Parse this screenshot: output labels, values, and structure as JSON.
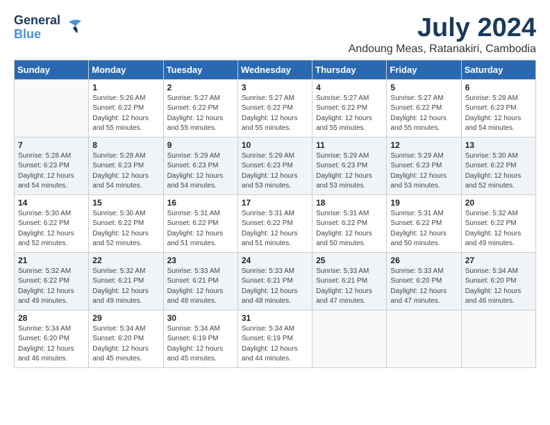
{
  "header": {
    "logo_general": "General",
    "logo_blue": "Blue",
    "month_year": "July 2024",
    "location": "Andoung Meas, Ratanakiri, Cambodia"
  },
  "weekdays": [
    "Sunday",
    "Monday",
    "Tuesday",
    "Wednesday",
    "Thursday",
    "Friday",
    "Saturday"
  ],
  "weeks": [
    [
      {
        "day": "",
        "info": ""
      },
      {
        "day": "1",
        "info": "Sunrise: 5:26 AM\nSunset: 6:22 PM\nDaylight: 12 hours\nand 55 minutes."
      },
      {
        "day": "2",
        "info": "Sunrise: 5:27 AM\nSunset: 6:22 PM\nDaylight: 12 hours\nand 55 minutes."
      },
      {
        "day": "3",
        "info": "Sunrise: 5:27 AM\nSunset: 6:22 PM\nDaylight: 12 hours\nand 55 minutes."
      },
      {
        "day": "4",
        "info": "Sunrise: 5:27 AM\nSunset: 6:22 PM\nDaylight: 12 hours\nand 55 minutes."
      },
      {
        "day": "5",
        "info": "Sunrise: 5:27 AM\nSunset: 6:22 PM\nDaylight: 12 hours\nand 55 minutes."
      },
      {
        "day": "6",
        "info": "Sunrise: 5:28 AM\nSunset: 6:23 PM\nDaylight: 12 hours\nand 54 minutes."
      }
    ],
    [
      {
        "day": "7",
        "info": "Sunrise: 5:28 AM\nSunset: 6:23 PM\nDaylight: 12 hours\nand 54 minutes."
      },
      {
        "day": "8",
        "info": "Sunrise: 5:28 AM\nSunset: 6:23 PM\nDaylight: 12 hours\nand 54 minutes."
      },
      {
        "day": "9",
        "info": "Sunrise: 5:29 AM\nSunset: 6:23 PM\nDaylight: 12 hours\nand 54 minutes."
      },
      {
        "day": "10",
        "info": "Sunrise: 5:29 AM\nSunset: 6:23 PM\nDaylight: 12 hours\nand 53 minutes."
      },
      {
        "day": "11",
        "info": "Sunrise: 5:29 AM\nSunset: 6:23 PM\nDaylight: 12 hours\nand 53 minutes."
      },
      {
        "day": "12",
        "info": "Sunrise: 5:29 AM\nSunset: 6:23 PM\nDaylight: 12 hours\nand 53 minutes."
      },
      {
        "day": "13",
        "info": "Sunrise: 5:30 AM\nSunset: 6:22 PM\nDaylight: 12 hours\nand 52 minutes."
      }
    ],
    [
      {
        "day": "14",
        "info": "Sunrise: 5:30 AM\nSunset: 6:22 PM\nDaylight: 12 hours\nand 52 minutes."
      },
      {
        "day": "15",
        "info": "Sunrise: 5:30 AM\nSunset: 6:22 PM\nDaylight: 12 hours\nand 52 minutes."
      },
      {
        "day": "16",
        "info": "Sunrise: 5:31 AM\nSunset: 6:22 PM\nDaylight: 12 hours\nand 51 minutes."
      },
      {
        "day": "17",
        "info": "Sunrise: 5:31 AM\nSunset: 6:22 PM\nDaylight: 12 hours\nand 51 minutes."
      },
      {
        "day": "18",
        "info": "Sunrise: 5:31 AM\nSunset: 6:22 PM\nDaylight: 12 hours\nand 50 minutes."
      },
      {
        "day": "19",
        "info": "Sunrise: 5:31 AM\nSunset: 6:22 PM\nDaylight: 12 hours\nand 50 minutes."
      },
      {
        "day": "20",
        "info": "Sunrise: 5:32 AM\nSunset: 6:22 PM\nDaylight: 12 hours\nand 49 minutes."
      }
    ],
    [
      {
        "day": "21",
        "info": "Sunrise: 5:32 AM\nSunset: 6:22 PM\nDaylight: 12 hours\nand 49 minutes."
      },
      {
        "day": "22",
        "info": "Sunrise: 5:32 AM\nSunset: 6:21 PM\nDaylight: 12 hours\nand 49 minutes."
      },
      {
        "day": "23",
        "info": "Sunrise: 5:33 AM\nSunset: 6:21 PM\nDaylight: 12 hours\nand 48 minutes."
      },
      {
        "day": "24",
        "info": "Sunrise: 5:33 AM\nSunset: 6:21 PM\nDaylight: 12 hours\nand 48 minutes."
      },
      {
        "day": "25",
        "info": "Sunrise: 5:33 AM\nSunset: 6:21 PM\nDaylight: 12 hours\nand 47 minutes."
      },
      {
        "day": "26",
        "info": "Sunrise: 5:33 AM\nSunset: 6:20 PM\nDaylight: 12 hours\nand 47 minutes."
      },
      {
        "day": "27",
        "info": "Sunrise: 5:34 AM\nSunset: 6:20 PM\nDaylight: 12 hours\nand 46 minutes."
      }
    ],
    [
      {
        "day": "28",
        "info": "Sunrise: 5:34 AM\nSunset: 6:20 PM\nDaylight: 12 hours\nand 46 minutes."
      },
      {
        "day": "29",
        "info": "Sunrise: 5:34 AM\nSunset: 6:20 PM\nDaylight: 12 hours\nand 45 minutes."
      },
      {
        "day": "30",
        "info": "Sunrise: 5:34 AM\nSunset: 6:19 PM\nDaylight: 12 hours\nand 45 minutes."
      },
      {
        "day": "31",
        "info": "Sunrise: 5:34 AM\nSunset: 6:19 PM\nDaylight: 12 hours\nand 44 minutes."
      },
      {
        "day": "",
        "info": ""
      },
      {
        "day": "",
        "info": ""
      },
      {
        "day": "",
        "info": ""
      }
    ]
  ]
}
